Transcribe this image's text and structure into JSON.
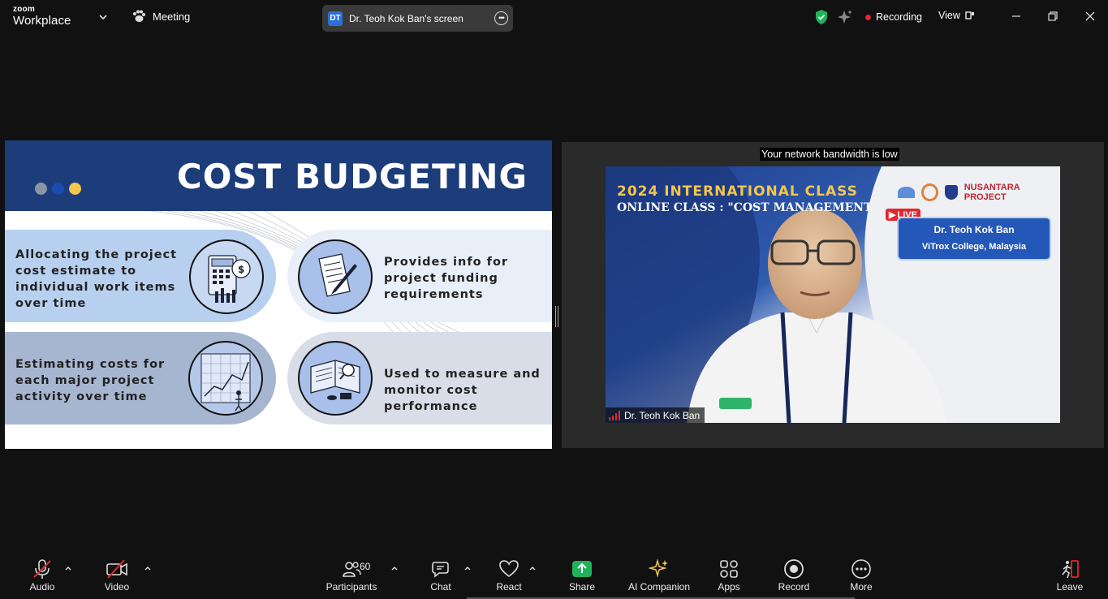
{
  "app": {
    "logo_line1": "zoom",
    "logo_line2": "Workplace",
    "meeting_label": "Meeting"
  },
  "share": {
    "avatar": "DT",
    "label": "Dr. Teoh Kok Ban's screen"
  },
  "status": {
    "recording": "Recording",
    "view": "View"
  },
  "slide": {
    "title": "COST BUDGETING",
    "dot_colors": [
      "#8c95a8",
      "#1a4bb0",
      "#f3c64f"
    ],
    "items": [
      {
        "text_lines": [
          "Allocating the project",
          "cost estimate to",
          "individual work items",
          "over time"
        ],
        "icon": "calculator-money-icon"
      },
      {
        "text_lines": [
          "Provides info for",
          "project funding",
          "requirements"
        ],
        "icon": "document-pen-icon"
      },
      {
        "text_lines": [
          "Estimating costs for",
          "each major project",
          "activity over time"
        ],
        "icon": "timeline-chart-icon"
      },
      {
        "text_lines": [
          "Used to measure and",
          "monitor cost performance"
        ],
        "icon": "ledger-magnifier-icon"
      }
    ]
  },
  "video": {
    "bandwidth_note": "Your network bandwidth is low",
    "banner_line1": "2024 INTERNATIONAL CLASS",
    "banner_line2": "ONLINE CLASS : \"COST MANAGEMENT",
    "live": "LIVE",
    "partner": "NUSANTARA PROJECT",
    "speaker_name": "Dr. Teoh Kok Ban",
    "speaker_org": "ViTrox College, Malaysia",
    "participant_name": "Dr. Teoh Kok Ban"
  },
  "toolbar": {
    "audio": "Audio",
    "video": "Video",
    "participants": "Participants",
    "participants_count": "60",
    "chat": "Chat",
    "react": "React",
    "share": "Share",
    "ai": "AI Companion",
    "apps": "Apps",
    "record": "Record",
    "more": "More",
    "leave": "Leave"
  },
  "colors": {
    "share_green": "#1fb25a",
    "recording_red": "#e3262f",
    "slide_navy": "#1c3d7a",
    "shield_green": "#1fb25a"
  }
}
